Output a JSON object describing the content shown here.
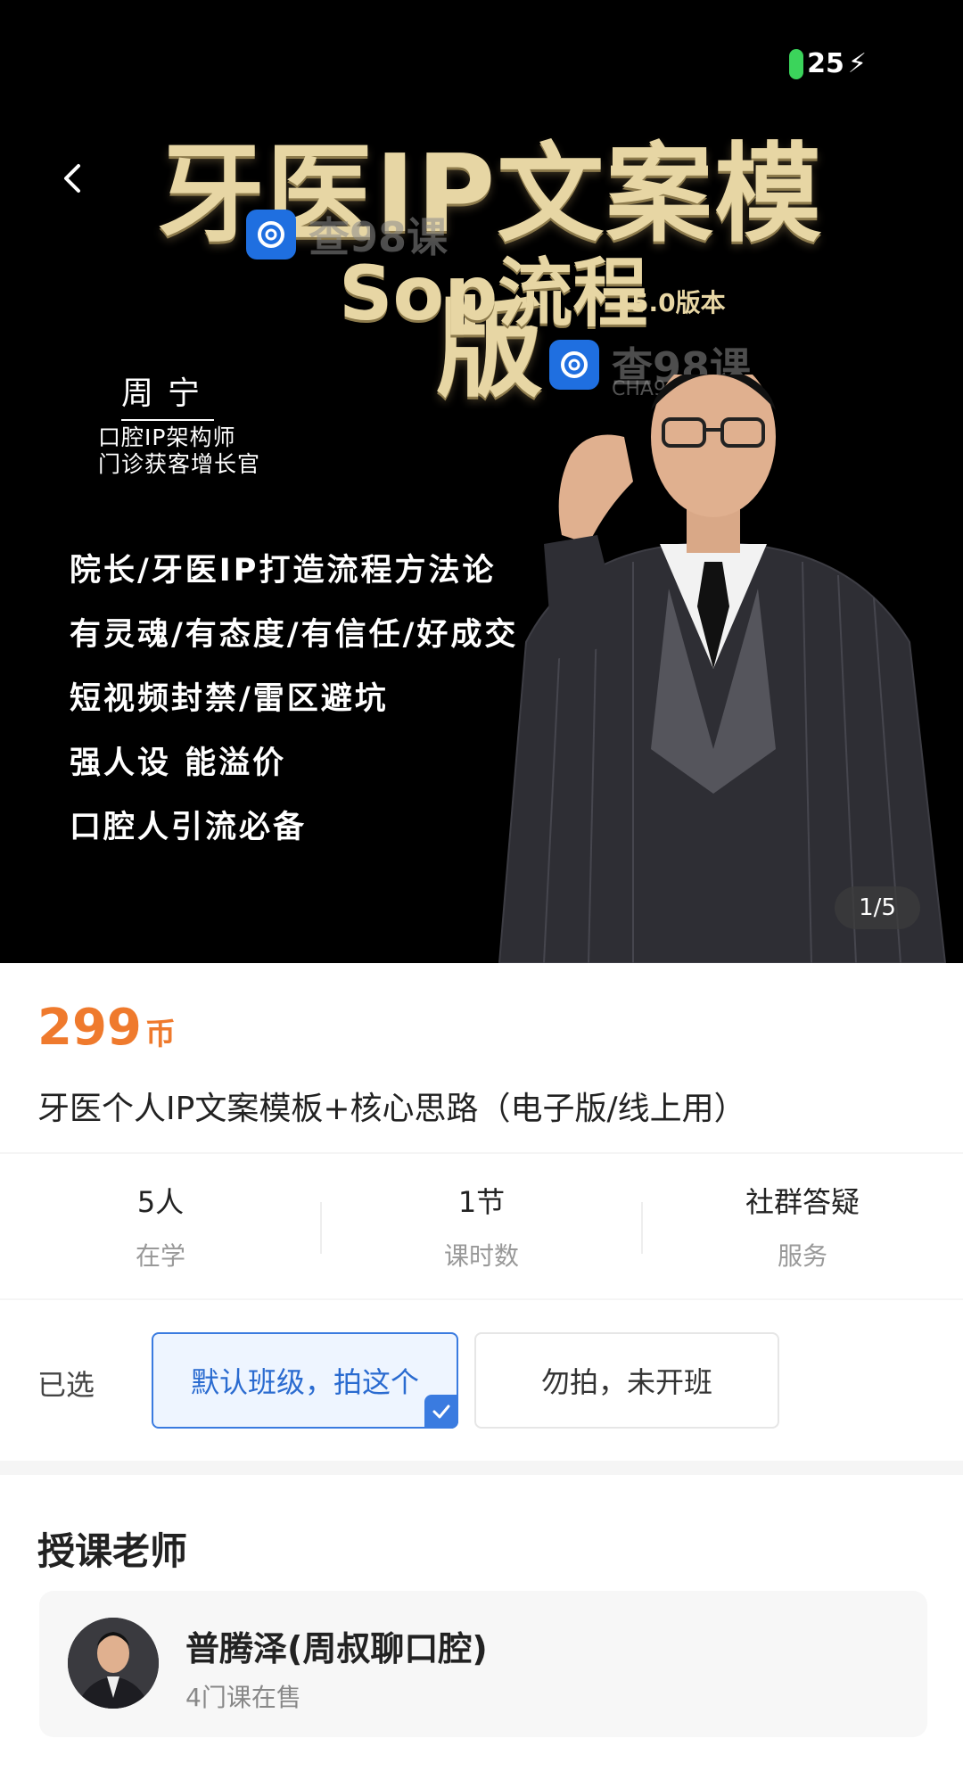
{
  "status_bar": {
    "battery": "25"
  },
  "banner": {
    "title_line1": "牙医IP文案模版",
    "title_line2": "Sop流程",
    "version": "5.0版本",
    "watermark_text": "查98课",
    "watermark_sub": "CHA98KE.COM",
    "author_name": "周宁",
    "author_roles": [
      "口腔IP架构师",
      "门诊获客增长官"
    ],
    "selling_points": [
      "院长/牙医IP打造流程方法论",
      "有灵魂/有态度/有信任/好成交",
      "短视频封禁/雷区避坑",
      "强人设 能溢价",
      "口腔人引流必备"
    ],
    "pager": "1/5"
  },
  "product": {
    "price": "299",
    "currency": "币",
    "title": "牙医个人IP文案模板+核心思路（电子版/线上用）"
  },
  "stats": [
    {
      "value": "5人",
      "label": "在学"
    },
    {
      "value": "1节",
      "label": "课时数"
    },
    {
      "value": "社群答疑",
      "label": "服务"
    }
  ],
  "class_select": {
    "label": "已选",
    "options": [
      "默认班级，拍这个",
      "勿拍，未开班"
    ],
    "selected_index": 0
  },
  "teacher": {
    "section_title": "授课老师",
    "name": "普腾泽(周叔聊口腔)",
    "courses": "4门课在售"
  },
  "colors": {
    "price": "#ef7a2d",
    "accent": "#3a7be0",
    "title_gold": "#e7d6a4"
  }
}
